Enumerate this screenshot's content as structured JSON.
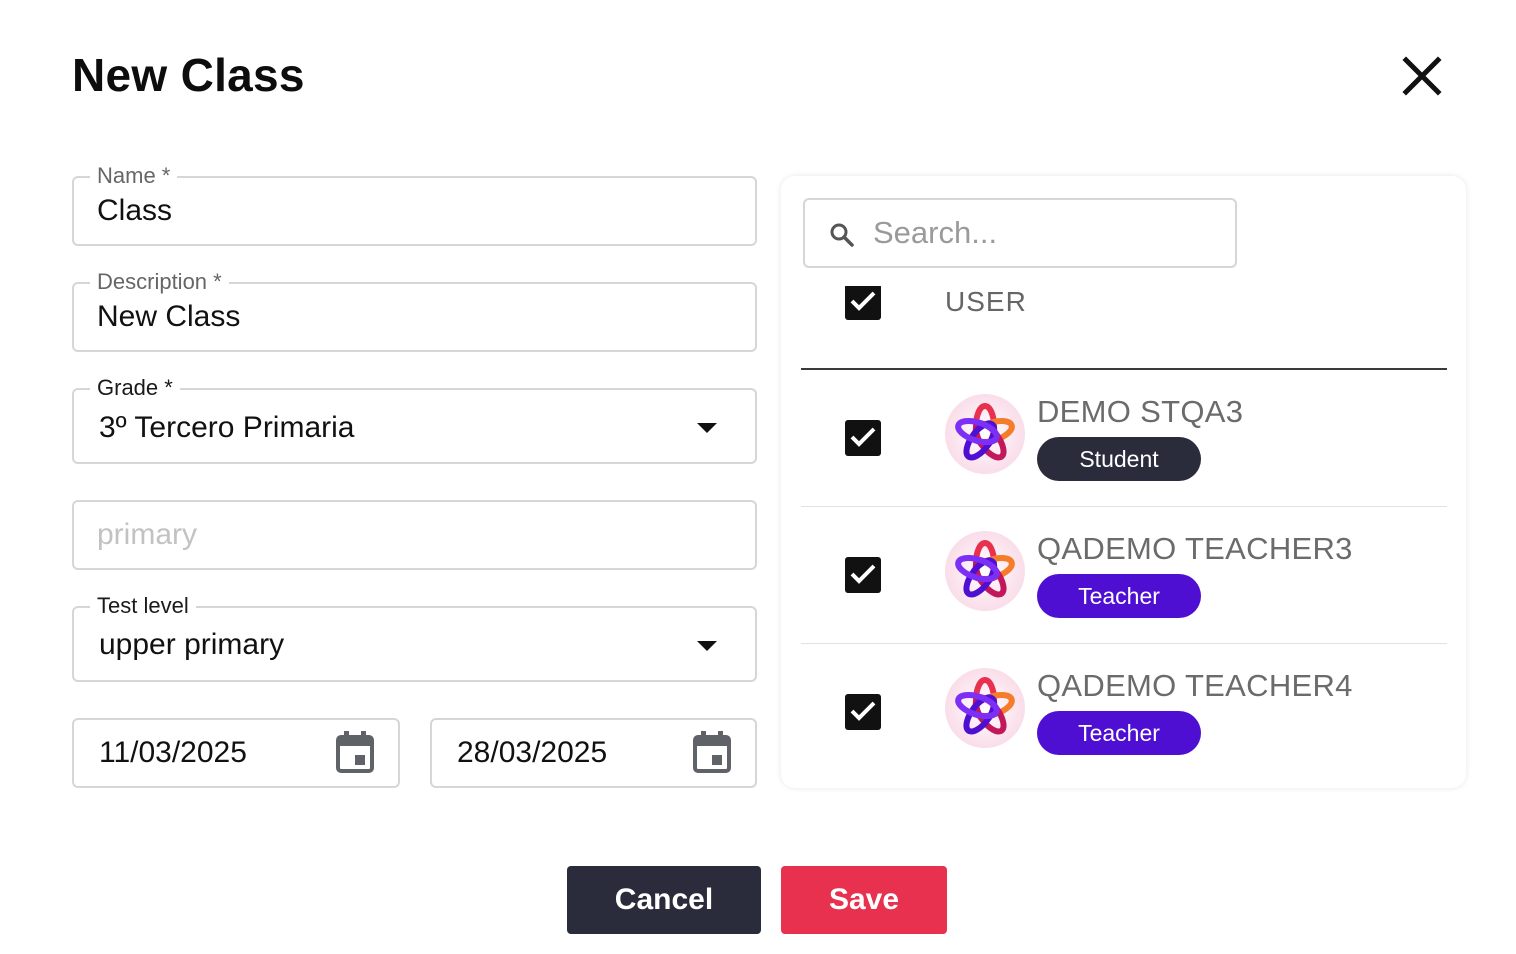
{
  "dialog": {
    "title": "New Class",
    "close_icon": "close-icon"
  },
  "form": {
    "name": {
      "label": "Name *",
      "value": "Class"
    },
    "description": {
      "label": "Description *",
      "value": "New Class"
    },
    "grade": {
      "label": "Grade *",
      "value": "3º Tercero Primaria"
    },
    "level_text": {
      "placeholder": "primary"
    },
    "test_level": {
      "label": "Test level",
      "value": "upper primary"
    },
    "start_date": {
      "value": "11/03/2025"
    },
    "end_date": {
      "value": "28/03/2025"
    }
  },
  "users_panel": {
    "search": {
      "placeholder": "Search..."
    },
    "column_header": "USER",
    "users": [
      {
        "name": "DEMO STQA3",
        "role": "Student",
        "checked": true
      },
      {
        "name": "QADEMO TEACHER3",
        "role": "Teacher",
        "checked": true
      },
      {
        "name": "QADEMO TEACHER4",
        "role": "Teacher",
        "checked": true
      }
    ]
  },
  "actions": {
    "cancel_label": "Cancel",
    "save_label": "Save"
  },
  "colors": {
    "save": "#e8304f",
    "cancel": "#2a2c3b",
    "student_badge": "#2a2c3b",
    "teacher_badge": "#4f0fd3"
  }
}
